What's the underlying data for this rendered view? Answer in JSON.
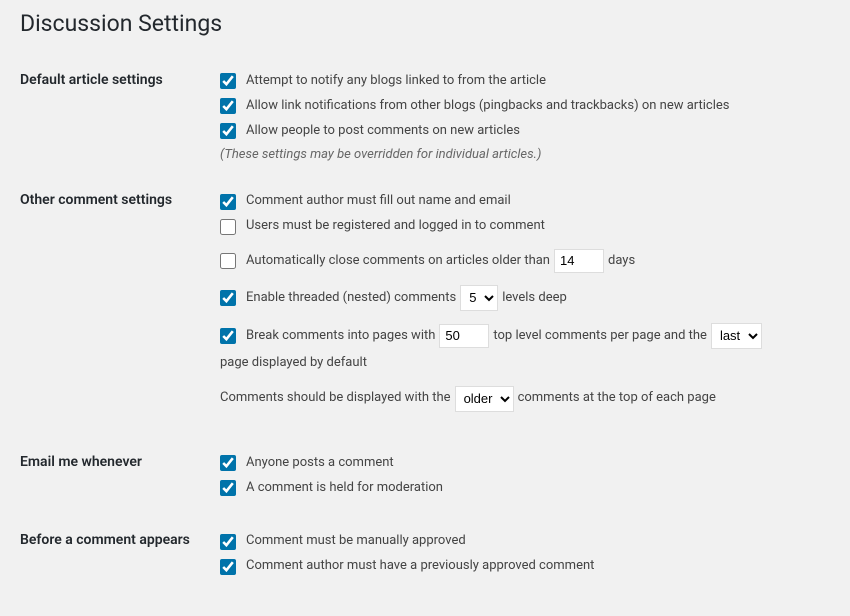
{
  "page_title": "Discussion Settings",
  "sections": {
    "default_article": {
      "heading": "Default article settings",
      "pingback_flag": "Attempt to notify any blogs linked to from the article",
      "ping_status": "Allow link notifications from other blogs (pingbacks and trackbacks) on new articles",
      "comment_status": "Allow people to post comments on new articles",
      "note": "(These settings may be overridden for individual articles.)"
    },
    "other_comment": {
      "heading": "Other comment settings",
      "require_name_email": "Comment author must fill out name and email",
      "require_registration": "Users must be registered and logged in to comment",
      "close_old_before": "Automatically close comments on articles older than",
      "close_old_value": "14",
      "close_old_after": "days",
      "threaded_before": "Enable threaded (nested) comments",
      "threaded_value": "5",
      "threaded_after": "levels deep",
      "paged_before": "Break comments into pages with",
      "paged_per_page_value": "50",
      "paged_mid": "top level comments per page and the",
      "paged_default_page": "last",
      "paged_after": "page displayed by default",
      "order_before": "Comments should be displayed with the",
      "order_value": "older",
      "order_after": "comments at the top of each page"
    },
    "email_me": {
      "heading": "Email me whenever",
      "comments_notify": "Anyone posts a comment",
      "moderation_notify": "A comment is held for moderation"
    },
    "before_appears": {
      "heading": "Before a comment appears",
      "comment_moderation": "Comment must be manually approved",
      "comment_previously": "Comment author must have a previously approved comment"
    }
  }
}
